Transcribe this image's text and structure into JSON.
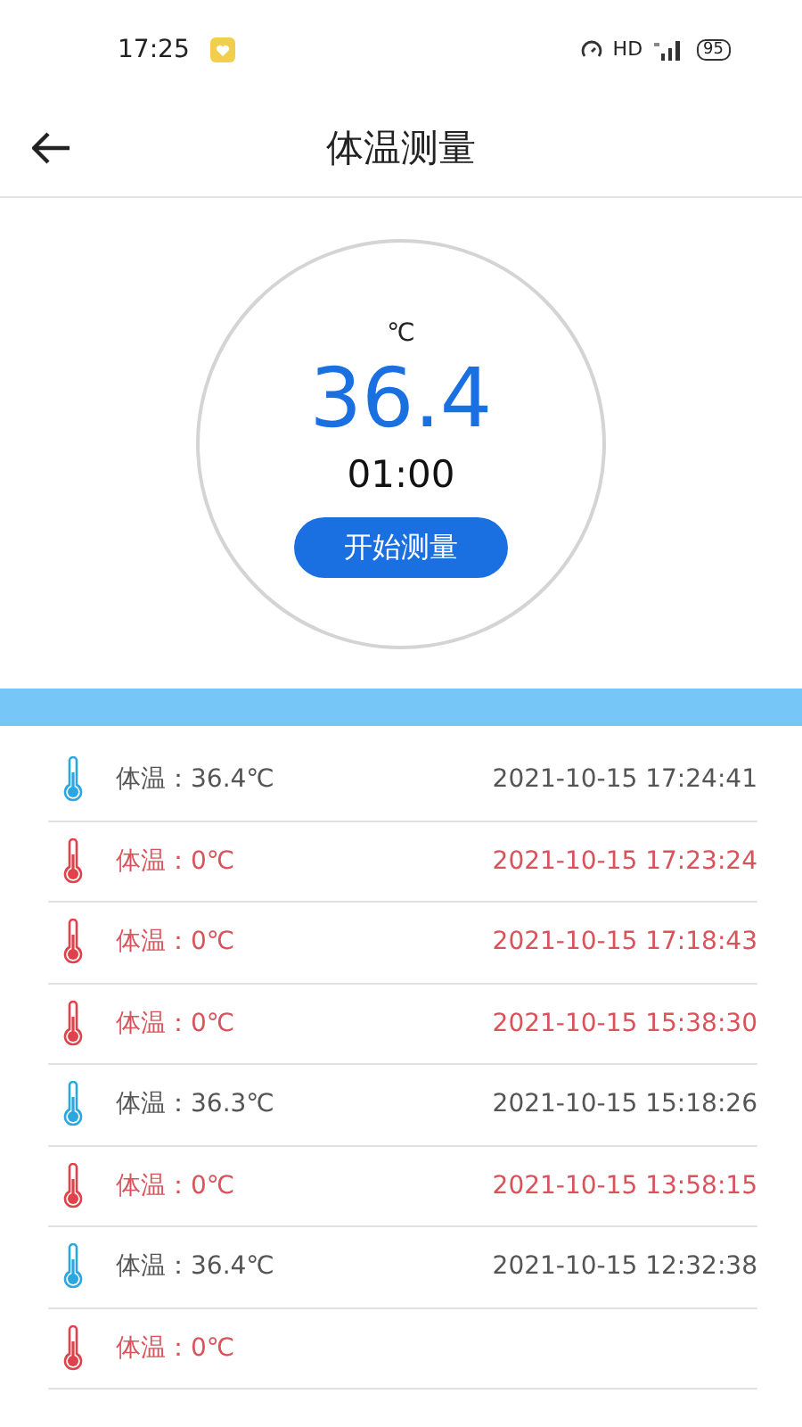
{
  "status_bar": {
    "time": "17:25",
    "network": "HD",
    "battery": "95"
  },
  "header": {
    "title": "体温测量"
  },
  "gauge": {
    "unit": "℃",
    "value": "36.4",
    "timer": "01:00",
    "button": "开始测量"
  },
  "records": [
    {
      "kind": "normal",
      "label": "体温：36.4℃",
      "time": "2021-10-15 17:24:41"
    },
    {
      "kind": "alert",
      "label": "体温：0℃",
      "time": "2021-10-15 17:23:24"
    },
    {
      "kind": "alert",
      "label": "体温：0℃",
      "time": "2021-10-15 17:18:43"
    },
    {
      "kind": "alert",
      "label": "体温：0℃",
      "time": "2021-10-15 15:38:30"
    },
    {
      "kind": "normal",
      "label": "体温：36.3℃",
      "time": "2021-10-15 15:18:26"
    },
    {
      "kind": "alert",
      "label": "体温：0℃",
      "time": "2021-10-15 13:58:15"
    },
    {
      "kind": "normal",
      "label": "体温：36.4℃",
      "time": "2021-10-15 12:32:38"
    },
    {
      "kind": "alert",
      "label": "体温：0℃"
    }
  ]
}
